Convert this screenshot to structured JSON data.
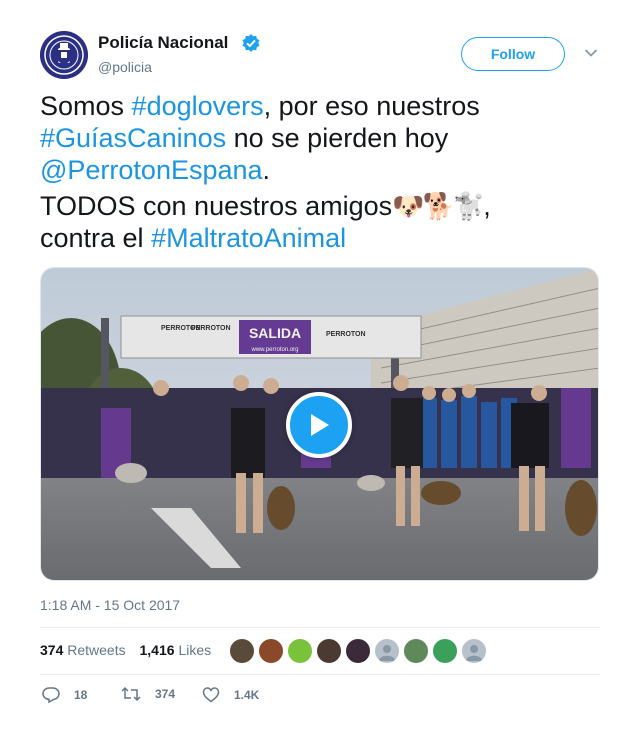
{
  "account": {
    "name": "Policía Nacional",
    "handle": "@policia",
    "verified_icon": "verified-badge-icon",
    "follow_label": "Follow"
  },
  "tweet": {
    "line1": {
      "a": "Somos ",
      "tag": "#doglovers",
      "b": ", por eso nuestros"
    },
    "line2": {
      "tag": "#GuíasCaninos",
      "b": " no se pierden hoy"
    },
    "line3": {
      "mention": "@PerrotonEspana",
      "b": "."
    },
    "line4": {
      "a": "TODOS con nuestros amigos",
      "emojis": "🐶🐕🐩",
      "b": ","
    },
    "line5": {
      "a": "contra el ",
      "tag": "#MaltratoAnimal"
    }
  },
  "media": {
    "arch_label": "SALIDA",
    "arch_url": "www.perroton.org",
    "brand_label": "PERROTON",
    "play_icon": "play-icon"
  },
  "timestamp": "1:18 AM - 15 Oct 2017",
  "stats": {
    "retweets_count": "374",
    "retweets_label": "Retweets",
    "likes_count": "1,416",
    "likes_label": "Likes"
  },
  "actions": {
    "reply_count": "18",
    "retweet_count": "374",
    "like_count": "1.4K"
  },
  "colors": {
    "accent": "#1da1f2",
    "link": "#1b95e0",
    "text": "#14171a",
    "muted": "#657786"
  }
}
